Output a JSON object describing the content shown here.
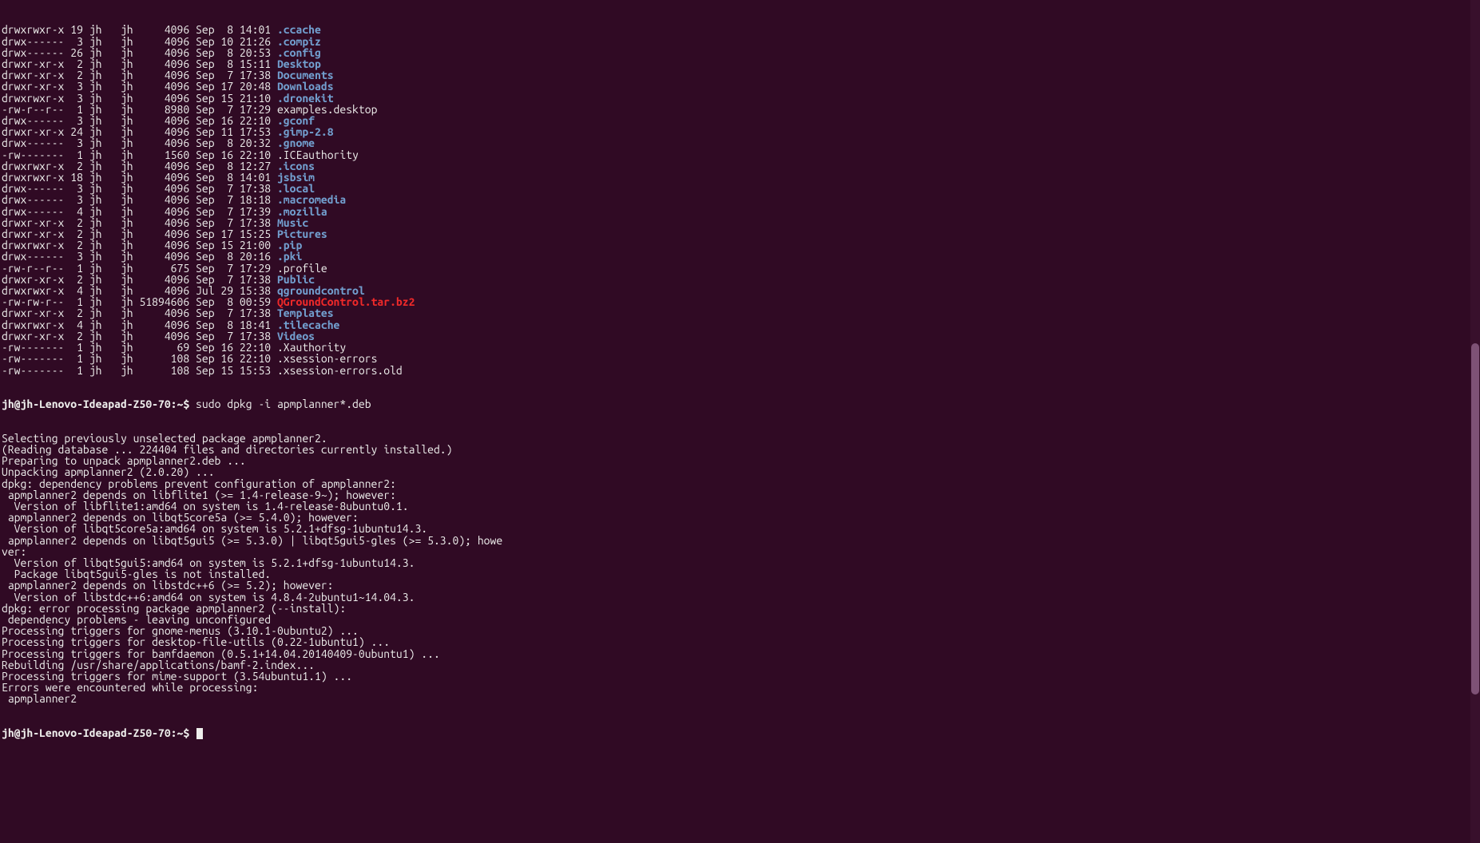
{
  "ls_entries": [
    {
      "perm": "drwxrwxr-x",
      "links": "19",
      "owner": "jh",
      "group": "jh",
      "size": "4096",
      "month": "Sep",
      "day": " 8",
      "time": "14:01",
      "name": ".ccache",
      "cls": "dir"
    },
    {
      "perm": "drwx------",
      "links": " 3",
      "owner": "jh",
      "group": "jh",
      "size": "4096",
      "month": "Sep",
      "day": "10",
      "time": "21:26",
      "name": ".compiz",
      "cls": "dir"
    },
    {
      "perm": "drwx------",
      "links": "26",
      "owner": "jh",
      "group": "jh",
      "size": "4096",
      "month": "Sep",
      "day": " 8",
      "time": "20:53",
      "name": ".config",
      "cls": "dir"
    },
    {
      "perm": "drwxr-xr-x",
      "links": " 2",
      "owner": "jh",
      "group": "jh",
      "size": "4096",
      "month": "Sep",
      "day": " 8",
      "time": "15:11",
      "name": "Desktop",
      "cls": "dir"
    },
    {
      "perm": "drwxr-xr-x",
      "links": " 2",
      "owner": "jh",
      "group": "jh",
      "size": "4096",
      "month": "Sep",
      "day": " 7",
      "time": "17:38",
      "name": "Documents",
      "cls": "dir"
    },
    {
      "perm": "drwxr-xr-x",
      "links": " 3",
      "owner": "jh",
      "group": "jh",
      "size": "4096",
      "month": "Sep",
      "day": "17",
      "time": "20:48",
      "name": "Downloads",
      "cls": "dir"
    },
    {
      "perm": "drwxrwxr-x",
      "links": " 3",
      "owner": "jh",
      "group": "jh",
      "size": "4096",
      "month": "Sep",
      "day": "15",
      "time": "21:10",
      "name": ".dronekit",
      "cls": "dir"
    },
    {
      "perm": "-rw-r--r--",
      "links": " 1",
      "owner": "jh",
      "group": "jh",
      "size": "8980",
      "month": "Sep",
      "day": " 7",
      "time": "17:29",
      "name": "examples.desktop",
      "cls": "file"
    },
    {
      "perm": "drwx------",
      "links": " 3",
      "owner": "jh",
      "group": "jh",
      "size": "4096",
      "month": "Sep",
      "day": "16",
      "time": "22:10",
      "name": ".gconf",
      "cls": "dir"
    },
    {
      "perm": "drwxr-xr-x",
      "links": "24",
      "owner": "jh",
      "group": "jh",
      "size": "4096",
      "month": "Sep",
      "day": "11",
      "time": "17:53",
      "name": ".gimp-2.8",
      "cls": "dir"
    },
    {
      "perm": "drwx------",
      "links": " 3",
      "owner": "jh",
      "group": "jh",
      "size": "4096",
      "month": "Sep",
      "day": " 8",
      "time": "20:32",
      "name": ".gnome",
      "cls": "dir"
    },
    {
      "perm": "-rw-------",
      "links": " 1",
      "owner": "jh",
      "group": "jh",
      "size": "1560",
      "month": "Sep",
      "day": "16",
      "time": "22:10",
      "name": ".ICEauthority",
      "cls": "file"
    },
    {
      "perm": "drwxrwxr-x",
      "links": " 2",
      "owner": "jh",
      "group": "jh",
      "size": "4096",
      "month": "Sep",
      "day": " 8",
      "time": "12:27",
      "name": ".icons",
      "cls": "dir"
    },
    {
      "perm": "drwxrwxr-x",
      "links": "18",
      "owner": "jh",
      "group": "jh",
      "size": "4096",
      "month": "Sep",
      "day": " 8",
      "time": "14:01",
      "name": "jsbsim",
      "cls": "dir"
    },
    {
      "perm": "drwx------",
      "links": " 3",
      "owner": "jh",
      "group": "jh",
      "size": "4096",
      "month": "Sep",
      "day": " 7",
      "time": "17:38",
      "name": ".local",
      "cls": "dir"
    },
    {
      "perm": "drwx------",
      "links": " 3",
      "owner": "jh",
      "group": "jh",
      "size": "4096",
      "month": "Sep",
      "day": " 7",
      "time": "18:18",
      "name": ".macromedia",
      "cls": "dir"
    },
    {
      "perm": "drwx------",
      "links": " 4",
      "owner": "jh",
      "group": "jh",
      "size": "4096",
      "month": "Sep",
      "day": " 7",
      "time": "17:39",
      "name": ".mozilla",
      "cls": "dir"
    },
    {
      "perm": "drwxr-xr-x",
      "links": " 2",
      "owner": "jh",
      "group": "jh",
      "size": "4096",
      "month": "Sep",
      "day": " 7",
      "time": "17:38",
      "name": "Music",
      "cls": "dir"
    },
    {
      "perm": "drwxr-xr-x",
      "links": " 2",
      "owner": "jh",
      "group": "jh",
      "size": "4096",
      "month": "Sep",
      "day": "17",
      "time": "15:25",
      "name": "Pictures",
      "cls": "dir"
    },
    {
      "perm": "drwxrwxr-x",
      "links": " 2",
      "owner": "jh",
      "group": "jh",
      "size": "4096",
      "month": "Sep",
      "day": "15",
      "time": "21:00",
      "name": ".pip",
      "cls": "dir"
    },
    {
      "perm": "drwx------",
      "links": " 3",
      "owner": "jh",
      "group": "jh",
      "size": "4096",
      "month": "Sep",
      "day": " 8",
      "time": "20:16",
      "name": ".pki",
      "cls": "dir"
    },
    {
      "perm": "-rw-r--r--",
      "links": " 1",
      "owner": "jh",
      "group": "jh",
      "size": "675",
      "month": "Sep",
      "day": " 7",
      "time": "17:29",
      "name": ".profile",
      "cls": "file"
    },
    {
      "perm": "drwxr-xr-x",
      "links": " 2",
      "owner": "jh",
      "group": "jh",
      "size": "4096",
      "month": "Sep",
      "day": " 7",
      "time": "17:38",
      "name": "Public",
      "cls": "dir"
    },
    {
      "perm": "drwxrwxr-x",
      "links": " 4",
      "owner": "jh",
      "group": "jh",
      "size": "4096",
      "month": "Jul",
      "day": "29",
      "time": "15:38",
      "name": "qgroundcontrol",
      "cls": "dir"
    },
    {
      "perm": "-rw-rw-r--",
      "links": " 1",
      "owner": "jh",
      "group": "jh",
      "size": "51894606",
      "month": "Sep",
      "day": " 8",
      "time": "00:59",
      "name": "QGroundControl.tar.bz2",
      "cls": "archive"
    },
    {
      "perm": "drwxr-xr-x",
      "links": " 2",
      "owner": "jh",
      "group": "jh",
      "size": "4096",
      "month": "Sep",
      "day": " 7",
      "time": "17:38",
      "name": "Templates",
      "cls": "dir"
    },
    {
      "perm": "drwxrwxr-x",
      "links": " 4",
      "owner": "jh",
      "group": "jh",
      "size": "4096",
      "month": "Sep",
      "day": " 8",
      "time": "18:41",
      "name": ".tilecache",
      "cls": "dir"
    },
    {
      "perm": "drwxr-xr-x",
      "links": " 2",
      "owner": "jh",
      "group": "jh",
      "size": "4096",
      "month": "Sep",
      "day": " 7",
      "time": "17:38",
      "name": "Videos",
      "cls": "dir"
    },
    {
      "perm": "-rw-------",
      "links": " 1",
      "owner": "jh",
      "group": "jh",
      "size": "69",
      "month": "Sep",
      "day": "16",
      "time": "22:10",
      "name": ".Xauthority",
      "cls": "file"
    },
    {
      "perm": "-rw-------",
      "links": " 1",
      "owner": "jh",
      "group": "jh",
      "size": "108",
      "month": "Sep",
      "day": "16",
      "time": "22:10",
      "name": ".xsession-errors",
      "cls": "file"
    },
    {
      "perm": "-rw-------",
      "links": " 1",
      "owner": "jh",
      "group": "jh",
      "size": "108",
      "month": "Sep",
      "day": "15",
      "time": "15:53",
      "name": ".xsession-errors.old",
      "cls": "file"
    }
  ],
  "cmd1_prompt": "jh@jh-Lenovo-Ideapad-Z50-70:~$ ",
  "cmd1": "sudo dpkg -i apmplanner*.deb",
  "dpkg_output": [
    "Selecting previously unselected package apmplanner2.",
    "(Reading database ... 224404 files and directories currently installed.)",
    "Preparing to unpack apmplanner2.deb ...",
    "Unpacking apmplanner2 (2.0.20) ...",
    "dpkg: dependency problems prevent configuration of apmplanner2:",
    " apmplanner2 depends on libflite1 (>= 1.4-release-9~); however:",
    "  Version of libflite1:amd64 on system is 1.4-release-8ubuntu0.1.",
    " apmplanner2 depends on libqt5core5a (>= 5.4.0); however:",
    "  Version of libqt5core5a:amd64 on system is 5.2.1+dfsg-1ubuntu14.3.",
    " apmplanner2 depends on libqt5gui5 (>= 5.3.0) | libqt5gui5-gles (>= 5.3.0); howe",
    "ver:",
    "  Version of libqt5gui5:amd64 on system is 5.2.1+dfsg-1ubuntu14.3.",
    "  Package libqt5gui5-gles is not installed.",
    " apmplanner2 depends on libstdc++6 (>= 5.2); however:",
    "  Version of libstdc++6:amd64 on system is 4.8.4-2ubuntu1~14.04.3.",
    "",
    "dpkg: error processing package apmplanner2 (--install):",
    " dependency problems - leaving unconfigured",
    "Processing triggers for gnome-menus (3.10.1-0ubuntu2) ...",
    "Processing triggers for desktop-file-utils (0.22-1ubuntu1) ...",
    "Processing triggers for bamfdaemon (0.5.1+14.04.20140409-0ubuntu1) ...",
    "Rebuilding /usr/share/applications/bamf-2.index...",
    "Processing triggers for mime-support (3.54ubuntu1.1) ...",
    "Errors were encountered while processing:",
    " apmplanner2"
  ],
  "cmd2_prompt": "jh@jh-Lenovo-Ideapad-Z50-70:~$ "
}
